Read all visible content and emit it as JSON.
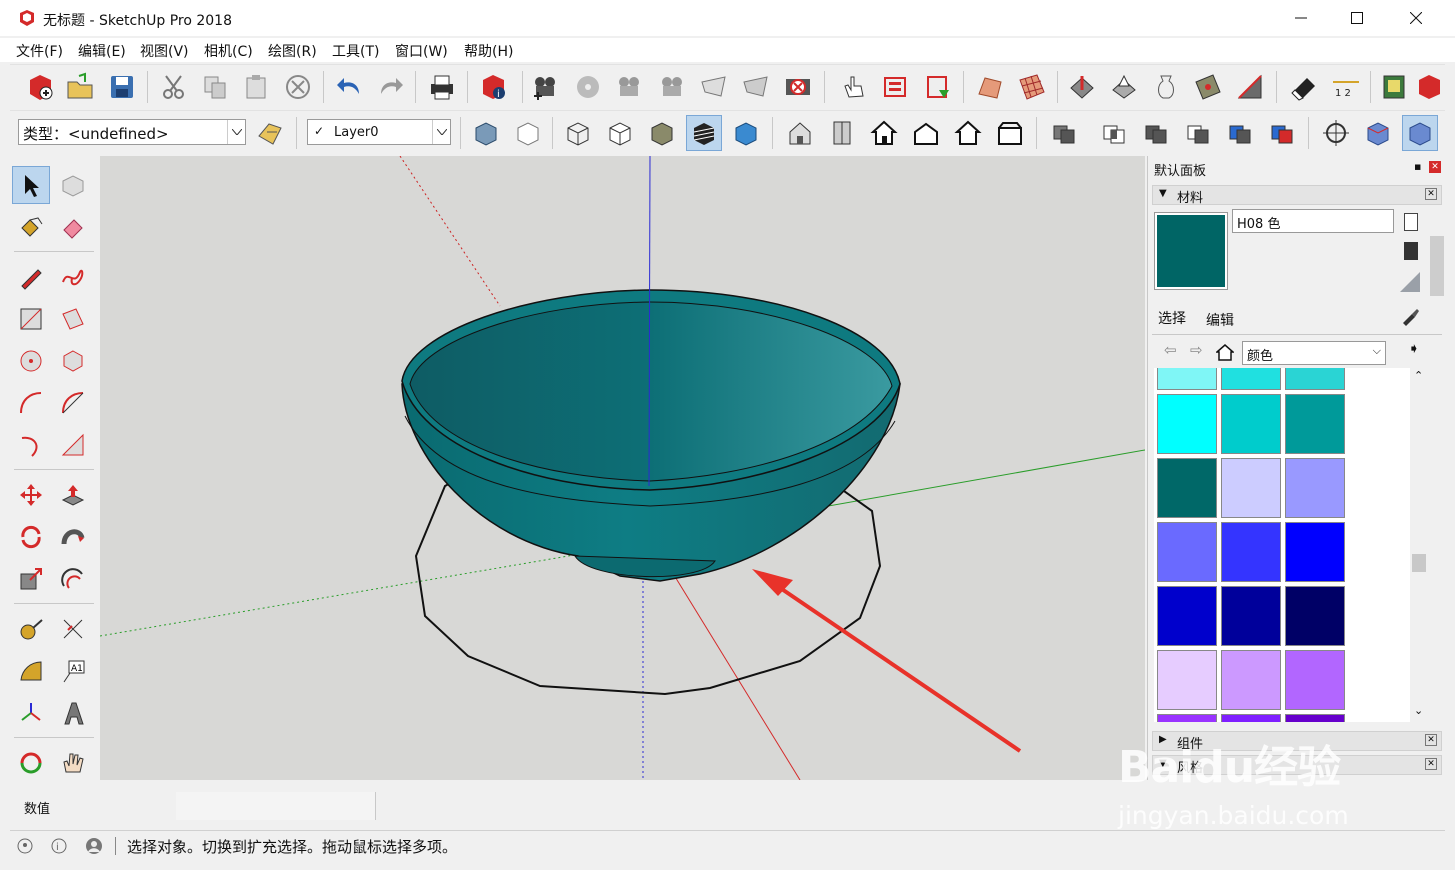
{
  "window": {
    "title": "无标题 - SketchUp Pro 2018"
  },
  "menu": [
    "文件(F)",
    "编辑(E)",
    "视图(V)",
    "相机(C)",
    "绘图(R)",
    "工具(T)",
    "窗口(W)",
    "帮助(H)"
  ],
  "toolbar2": {
    "type_label": "类型：<undefined>",
    "layer_value": "Layer0"
  },
  "tray": {
    "title": "默认面板",
    "materials_label": "材料",
    "material_name": "H08 色",
    "current_material_color": "#006565",
    "tab_select": "选择",
    "tab_edit": "编辑",
    "library_value": "颜色",
    "components_label": "组件",
    "styles_label": "风格"
  },
  "swatches": [
    [
      "#7ff6f6",
      "#20e0e0",
      "#2ad4d4"
    ],
    [
      "#00ffff",
      "#00cccc",
      "#009a9a"
    ],
    [
      "#006868",
      "#ccccff",
      "#9999ff"
    ],
    [
      "#6a6aff",
      "#3434ff",
      "#0000ff"
    ],
    [
      "#0000cc",
      "#00009b",
      "#000066"
    ],
    [
      "#e6ccff",
      "#cc99ff",
      "#b266ff"
    ],
    [
      "#9933ff",
      "#7f1fff",
      "#6600cc"
    ]
  ],
  "measurements_label": "数值",
  "status_text": "选择对象。切换到扩充选择。拖动鼠标选择多项。",
  "watermark": {
    "brand": "Baidu经验",
    "url": "jingyan.baidu.com"
  },
  "bowl_color": "#0a7a80"
}
